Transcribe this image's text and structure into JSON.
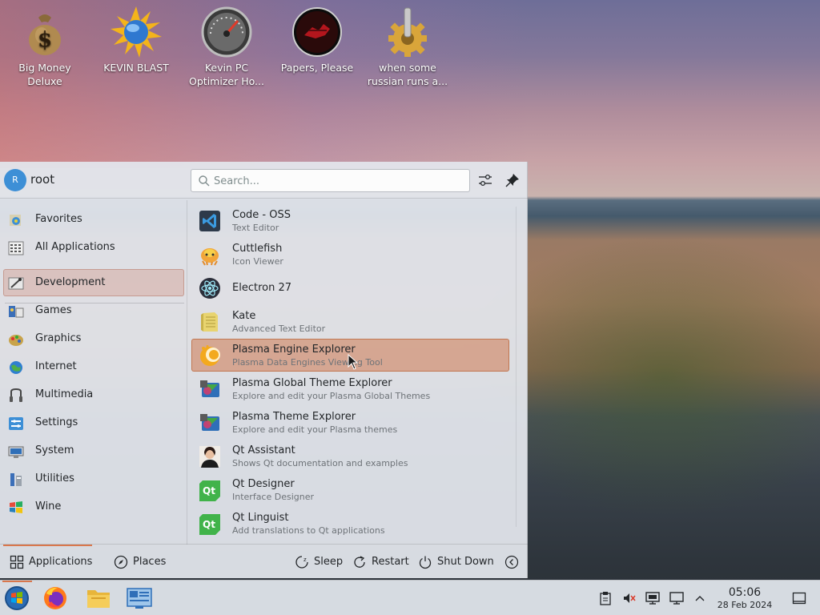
{
  "desktop": {
    "icons": [
      {
        "label": "Big Money Deluxe",
        "icon": "money-bag-icon"
      },
      {
        "label": "KEVIN BLAST",
        "icon": "blast-globe-icon"
      },
      {
        "label": "Kevin PC Optimizer Ho...",
        "icon": "speedometer-icon"
      },
      {
        "label": "Papers, Please",
        "icon": "papers-please-icon"
      },
      {
        "label": "when some russian runs a...",
        "icon": "gear-icon"
      }
    ]
  },
  "launcher": {
    "user": {
      "avatar_initial": "R",
      "name": "root"
    },
    "search": {
      "placeholder": "Search...",
      "value": ""
    },
    "categories": [
      {
        "label": "Favorites",
        "icon": "favorites-icon"
      },
      {
        "label": "All Applications",
        "icon": "all-applications-icon"
      },
      {
        "label": "Development",
        "icon": "development-icon",
        "selected": true
      },
      {
        "label": "Games",
        "icon": "games-icon"
      },
      {
        "label": "Graphics",
        "icon": "graphics-icon"
      },
      {
        "label": "Internet",
        "icon": "internet-icon"
      },
      {
        "label": "Multimedia",
        "icon": "multimedia-icon"
      },
      {
        "label": "Settings",
        "icon": "settings-icon"
      },
      {
        "label": "System",
        "icon": "system-icon"
      },
      {
        "label": "Utilities",
        "icon": "utilities-icon"
      },
      {
        "label": "Wine",
        "icon": "wine-icon"
      }
    ],
    "apps": [
      {
        "name": "Code - OSS",
        "desc": "Text Editor",
        "icon": "vscode-icon"
      },
      {
        "name": "Cuttlefish",
        "desc": "Icon Viewer",
        "icon": "cuttlefish-icon"
      },
      {
        "name": "Electron 27",
        "desc": "",
        "icon": "electron-icon"
      },
      {
        "name": "Kate",
        "desc": "Advanced Text Editor",
        "icon": "kate-icon"
      },
      {
        "name": "Plasma Engine Explorer",
        "desc": "Plasma Data Engines Viewing Tool",
        "icon": "plasma-engine-icon",
        "selected": true
      },
      {
        "name": "Plasma Global Theme Explorer",
        "desc": "Explore and edit your Plasma Global Themes",
        "icon": "plasma-theme-icon"
      },
      {
        "name": "Plasma Theme Explorer",
        "desc": "Explore and edit your Plasma themes",
        "icon": "plasma-theme-icon"
      },
      {
        "name": "Qt Assistant",
        "desc": "Shows Qt documentation and examples",
        "icon": "qt-assistant-icon"
      },
      {
        "name": "Qt Designer",
        "desc": "Interface Designer",
        "icon": "qt-designer-icon"
      },
      {
        "name": "Qt Linguist",
        "desc": "Add translations to Qt applications",
        "icon": "qt-linguist-icon"
      }
    ],
    "footer": {
      "applications_label": "Applications",
      "places_label": "Places",
      "sleep_label": "Sleep",
      "restart_label": "Restart",
      "shutdown_label": "Shut Down"
    }
  },
  "taskbar": {
    "items": [
      "start-menu-icon",
      "firefox-icon",
      "file-manager-icon",
      "system-settings-icon"
    ],
    "tray": [
      "clipboard-icon",
      "volume-muted-icon",
      "display-icon",
      "network-icon",
      "expand-tray-icon"
    ],
    "clock": {
      "time": "05:06",
      "date": "28 Feb 2024"
    },
    "show_desktop": "show-desktop-icon"
  },
  "colors": {
    "accent": "#d9774c",
    "selection": "#cd7850",
    "text": "#232629"
  }
}
